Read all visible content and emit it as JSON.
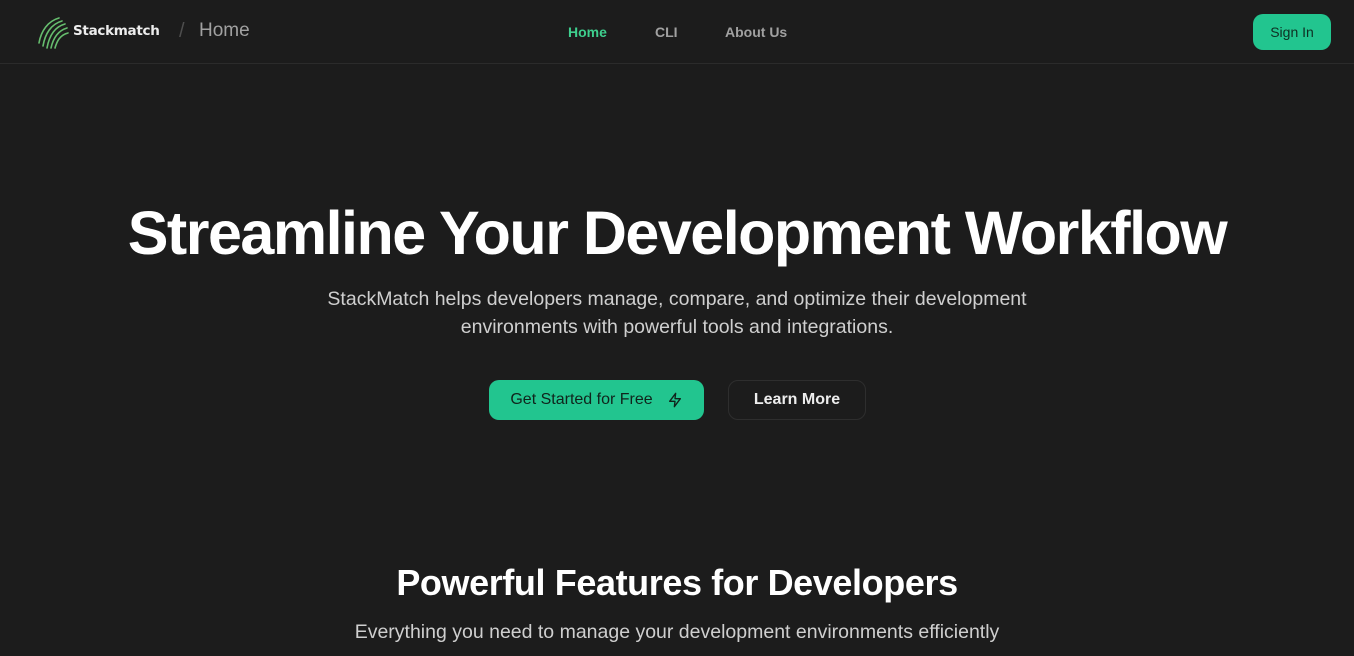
{
  "header": {
    "brand": "Stackmatch",
    "breadcrumb_separator": "/",
    "breadcrumb_page": "Home",
    "nav": {
      "home": "Home",
      "cli": "CLI",
      "about": "About Us"
    },
    "sign_in": "Sign In"
  },
  "hero": {
    "title": "Streamline Your Development Workflow",
    "subtitle": "StackMatch helps developers manage, compare, and optimize their development environments with powerful tools and integrations.",
    "primary_cta": "Get Started for Free",
    "primary_cta_icon": "lightning-icon",
    "secondary_cta": "Learn More"
  },
  "features": {
    "title": "Powerful Features for Developers",
    "subtitle": "Everything you need to manage your development environments efficiently"
  },
  "colors": {
    "background": "#1c1c1c",
    "accent": "#22c58f",
    "accent_text": "#3ecf8e",
    "border": "#2b2b2b"
  }
}
